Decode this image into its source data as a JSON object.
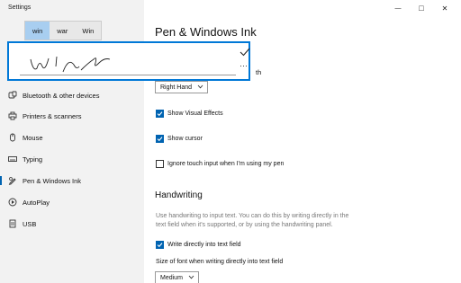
{
  "window": {
    "title": "Settings",
    "minimize": "—",
    "maximize": "□",
    "close": "✕"
  },
  "sidebar": {
    "items": [
      {
        "label": "Bluetooth & other devices",
        "icon": "bluetooth-icon"
      },
      {
        "label": "Printers & scanners",
        "icon": "printer-icon"
      },
      {
        "label": "Mouse",
        "icon": "mouse-icon"
      },
      {
        "label": "Typing",
        "icon": "keyboard-icon"
      },
      {
        "label": "Pen & Windows Ink",
        "icon": "pen-icon",
        "active": true
      },
      {
        "label": "AutoPlay",
        "icon": "autoplay-icon"
      },
      {
        "label": "USB",
        "icon": "usb-icon"
      }
    ]
  },
  "main": {
    "title": "Pen & Windows Ink",
    "partial_heading": "th",
    "hand_dropdown": "Right Hand",
    "checkboxes": [
      {
        "label": "Show Visual Effects",
        "checked": true
      },
      {
        "label": "Show cursor",
        "checked": true
      },
      {
        "label": "Ignore touch input when I'm using my pen",
        "checked": false
      }
    ],
    "handwriting": {
      "heading": "Handwriting",
      "description": "Use handwriting to input text. You can do this by writing directly in the text field when it's supported, or by using the handwriting panel.",
      "write_direct": {
        "label": "Write directly into text field",
        "checked": true
      },
      "font_size_label": "Size of font when writing directly into text field",
      "font_size_value": "Medium"
    }
  },
  "handwriting_panel": {
    "suggestions": [
      "win",
      "war",
      "Win"
    ],
    "selected_index": 0,
    "accent": "#0078d7"
  }
}
